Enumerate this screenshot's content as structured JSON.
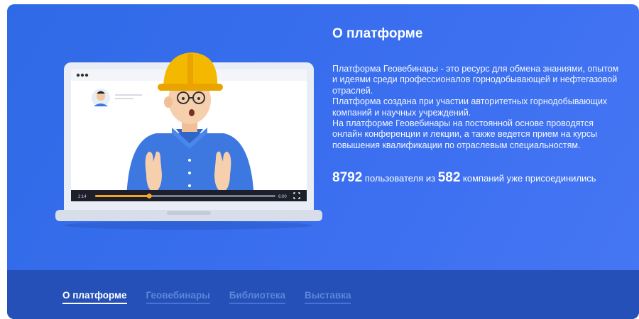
{
  "about": {
    "title": "О платформе",
    "paragraphs": [
      "Платформа Геовебинары - это ресурс для обмена знаниями, опытом и идеями среди профессионалов горнодобывающей и нефтегазовой отраслей.",
      "Платформа создана при участии авторитетных горнодобывающих компаний и научных учреждений.",
      "На платформе Геовебинары на постоянной основе проводятся онлайн конференции и лекции, а также ведется прием на курсы повышения квалификации по отраслевым специальностям."
    ],
    "stats": {
      "users_count": "8792",
      "users_text": "пользователя из",
      "companies_count": "582",
      "companies_text": "компаний уже присоединились"
    }
  },
  "video": {
    "time_current": "2:14",
    "time_total": "6:00",
    "progress": 0.3
  },
  "tabs": [
    {
      "label": "О платформе",
      "active": true
    },
    {
      "label": "Геовебинары",
      "active": false
    },
    {
      "label": "Библиотека",
      "active": false
    },
    {
      "label": "Выставка",
      "active": false
    }
  ],
  "colors": {
    "background": "#3b6ff0",
    "bottom_bar": "#2450b8",
    "helmet": "#f5b800",
    "shirt": "#3c78e0",
    "progress": "#f5a623"
  }
}
